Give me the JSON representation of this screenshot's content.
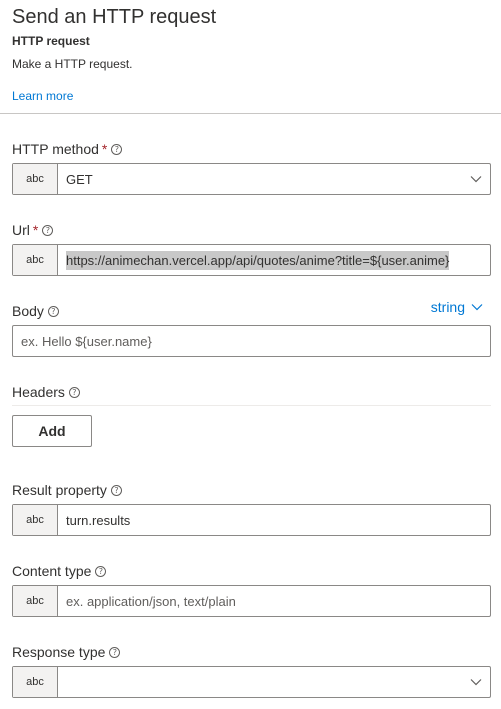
{
  "header": {
    "title": "Send an HTTP request",
    "subtitle": "HTTP request",
    "description": "Make a HTTP request.",
    "learn_more": "Learn more"
  },
  "fields": {
    "http_method": {
      "label": "HTTP method",
      "required_mark": "*",
      "type_badge": "abc",
      "value": "GET"
    },
    "url": {
      "label": "Url",
      "required_mark": "*",
      "type_badge": "abc",
      "value": "https://animechan.vercel.app/api/quotes/anime?title=${user.anime}"
    },
    "body": {
      "label": "Body",
      "type_toggle": "string",
      "placeholder": "ex. Hello ${user.name}"
    },
    "headers": {
      "label": "Headers",
      "add_label": "Add"
    },
    "result_property": {
      "label": "Result property",
      "type_badge": "abc",
      "value": "turn.results"
    },
    "content_type": {
      "label": "Content type",
      "type_badge": "abc",
      "placeholder": "ex. application/json, text/plain"
    },
    "response_type": {
      "label": "Response type",
      "type_badge": "abc",
      "value": ""
    }
  },
  "help_glyph": "?",
  "icons": {
    "help": "help-circle-icon",
    "dropdown": "chevron-down-icon"
  },
  "colors": {
    "link": "#0078d4",
    "required": "#a4262c",
    "border": "#8a8886",
    "badge_bg": "#f3f2f1"
  }
}
